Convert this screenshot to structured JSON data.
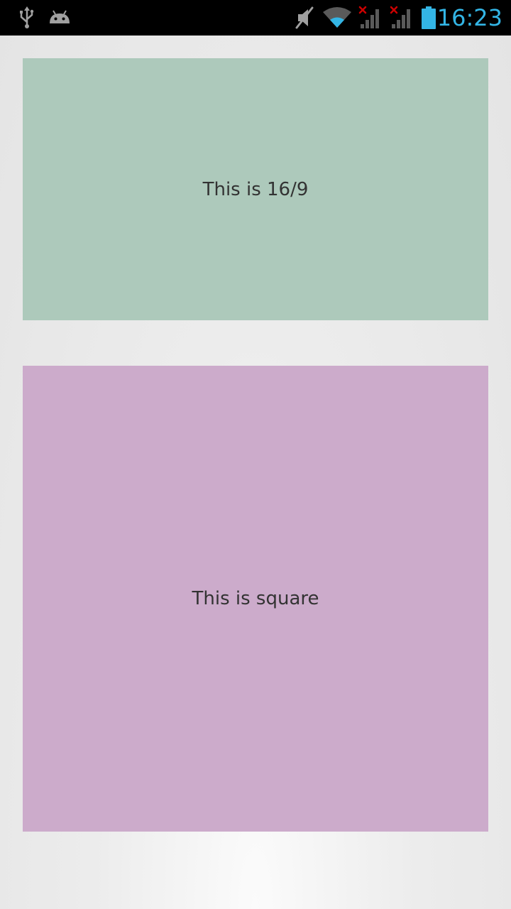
{
  "status_bar": {
    "time": "16:23",
    "icons": [
      "usb-icon",
      "android-debug-icon",
      "mute-icon",
      "wifi-icon",
      "signal-no-service-icon",
      "signal-no-service-icon",
      "battery-icon"
    ],
    "colors": {
      "background": "#000000",
      "clock": "#33b5e5",
      "icon_gray": "#a0a0a0",
      "x_mark": "#cc0000",
      "battery": "#33b5e5"
    }
  },
  "cards": [
    {
      "label": "This is 16/9",
      "color": "#adc9bb"
    },
    {
      "label": "This is square",
      "color": "#ccabcb"
    }
  ]
}
